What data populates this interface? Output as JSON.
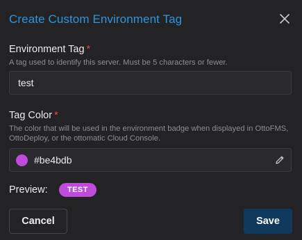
{
  "dialog": {
    "title": "Create Custom Environment Tag"
  },
  "env_tag": {
    "label": "Environment Tag",
    "required_marker": "*",
    "help": "A tag used to identify this server. Must be 5 characters or fewer.",
    "value": "test"
  },
  "tag_color": {
    "label": "Tag Color",
    "required_marker": "*",
    "help": "The color that will be used in the environment badge when displayed in OttoFMS, OttoDeploy, or the ottomatic Cloud Console.",
    "value": "#be4bdb",
    "swatch_color": "#be4bdb"
  },
  "preview": {
    "label": "Preview:",
    "badge_text": "TEST"
  },
  "actions": {
    "cancel_label": "Cancel",
    "save_label": "Save"
  },
  "icons": {
    "close": "close-icon",
    "edit": "pencil-icon"
  },
  "colors": {
    "title": "#2f95dc",
    "required": "#e5484d",
    "save_bg": "#0f3a5e"
  }
}
